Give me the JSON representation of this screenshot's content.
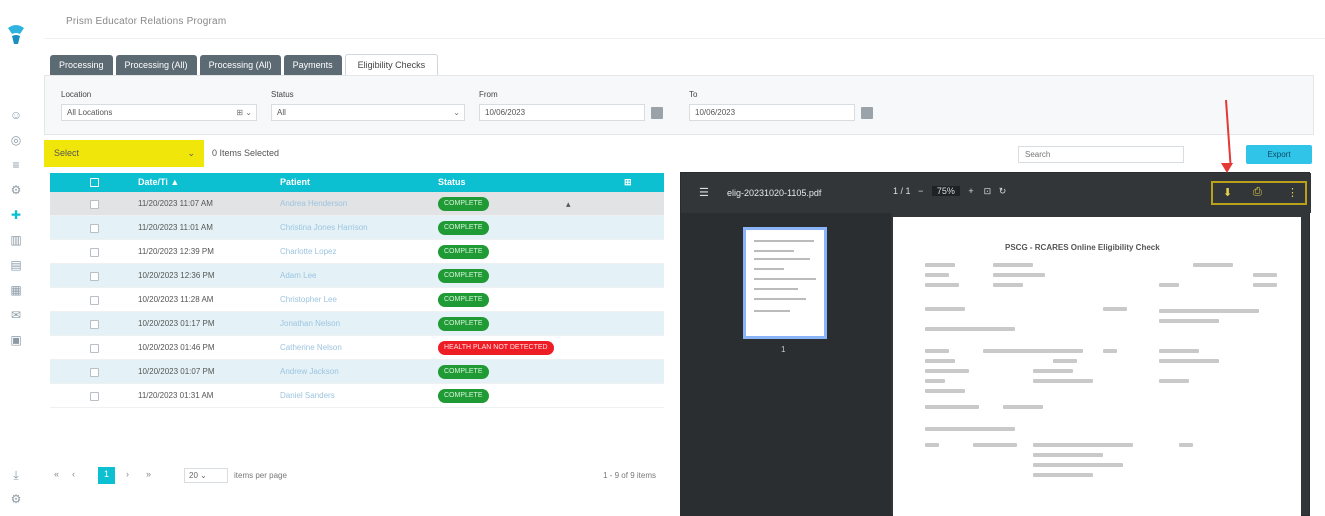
{
  "app": {
    "title": "Prism Educator Relations Program"
  },
  "tabs": [
    {
      "label": "Processing"
    },
    {
      "label": "Processing (All)"
    },
    {
      "label": "Processing (All)"
    },
    {
      "label": "Payments"
    },
    {
      "label": "Eligibility Checks"
    }
  ],
  "filters": {
    "location": {
      "label": "Location",
      "value": "All Locations"
    },
    "status": {
      "label": "Status",
      "value": "All"
    },
    "from": {
      "label": "From",
      "value": "10/06/2023"
    },
    "to": {
      "label": "To",
      "value": "10/06/2023"
    }
  },
  "toolbar": {
    "select_label": "Select",
    "selected_text": "0 Items Selected",
    "search_placeholder": "Search",
    "export_label": "Export"
  },
  "table": {
    "headers": {
      "datetime": "Date/Ti ▲",
      "patient": "Patient",
      "status": "Status"
    },
    "rows": [
      {
        "datetime": "11/20/2023 11:07 AM",
        "patient": "Andrea Henderson",
        "status": "COMPLETE",
        "status_color": "#1f9a35"
      },
      {
        "datetime": "11/20/2023 11:01 AM",
        "patient": "Christina Jones Harrison",
        "status": "COMPLETE",
        "status_color": "#1f9a35"
      },
      {
        "datetime": "11/20/2023 12:39 PM",
        "patient": "Charlotte Lopez",
        "status": "COMPLETE",
        "status_color": "#1f9a35"
      },
      {
        "datetime": "10/20/2023 12:36 PM",
        "patient": "Adam Lee",
        "status": "COMPLETE",
        "status_color": "#1f9a35"
      },
      {
        "datetime": "10/20/2023 11:28 AM",
        "patient": "Christopher Lee",
        "status": "COMPLETE",
        "status_color": "#1f9a35"
      },
      {
        "datetime": "10/20/2023 01:17 PM",
        "patient": "Jonathan Nelson",
        "status": "COMPLETE",
        "status_color": "#1f9a35"
      },
      {
        "datetime": "10/20/2023 01:46 PM",
        "patient": "Catherine Nelson",
        "status": "HEALTH PLAN NOT DETECTED",
        "status_color": "#ee1c25"
      },
      {
        "datetime": "10/20/2023 01:07 PM",
        "patient": "Andrew Jackson",
        "status": "COMPLETE",
        "status_color": "#1f9a35"
      },
      {
        "datetime": "11/20/2023 01:31 AM",
        "patient": "Daniel Sanders",
        "status": "COMPLETE",
        "status_color": "#1f9a35"
      }
    ]
  },
  "pagination": {
    "first": "«",
    "prev": "‹",
    "current": "1",
    "next": "›",
    "last": "»",
    "per_page": "20",
    "per_page_label": "items per page",
    "range": "1 - 9 of 9 items"
  },
  "pdf": {
    "filename": "elig-20231020-1105.pdf",
    "page_current": "1",
    "page_total": "/ 1",
    "zoom": "75%",
    "thumb_page": "1",
    "doc_title": "PSCG - RCARES Online Eligibility Check"
  },
  "colors": {
    "accent": "#0cbfd1",
    "highlight": "#f1e60a",
    "export": "#2fc4e8",
    "complete": "#1f9a35",
    "error": "#ee1c25"
  }
}
